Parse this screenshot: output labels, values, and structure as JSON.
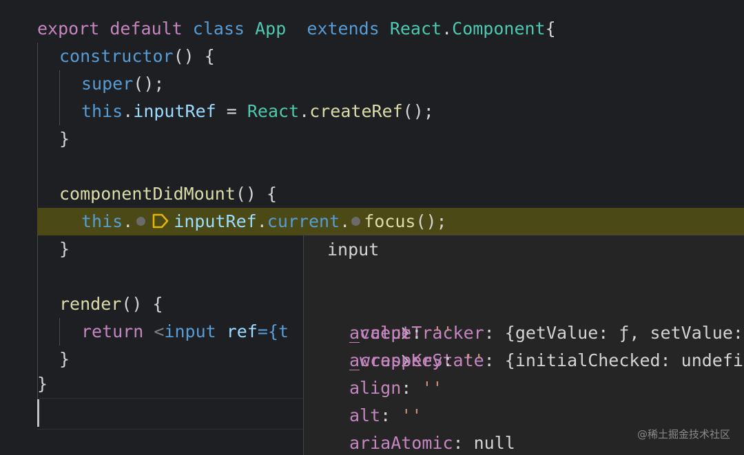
{
  "code": {
    "line1": {
      "export": "export",
      "default": "default",
      "class": "class",
      "name": "App",
      "extends": "extends",
      "react": "React",
      "dot": ".",
      "component": "Component",
      "brace": "{"
    },
    "line2": {
      "ctor": "constructor",
      "rest": "() {"
    },
    "line3": {
      "super": "super",
      "rest": "();"
    },
    "line4": {
      "this": "this",
      "dot": ".",
      "prop": "inputRef",
      "eq": " = ",
      "react": "React",
      "dot2": ".",
      "fn": "createRef",
      "rest": "();"
    },
    "line5": {
      "close": "}"
    },
    "line7": {
      "fn": "componentDidMount",
      "rest": "() {"
    },
    "line8": {
      "this": "this",
      "dot1": ".",
      "prop1": "inputRef",
      "dot2": ".",
      "prop2": "current",
      "dot3": ".",
      "fn": "focus",
      "rest": "();"
    },
    "line9": {
      "close": "}"
    },
    "line11": {
      "fn": "render",
      "rest": "() {"
    },
    "line12": {
      "ret": "return",
      "lt": " <",
      "tag": "input",
      "attr": " ref",
      "eq": "={",
      "partial": "t"
    },
    "line13": {
      "close": "}"
    },
    "line14": {
      "close": "}"
    }
  },
  "hover": {
    "title": "input",
    "rows": [
      {
        "key": "_valueTracker",
        "sep": ": ",
        "value": "{getValue: ƒ, setValue: ƒ",
        "type": "obj",
        "expandable": true
      },
      {
        "key": "_wrapperState",
        "sep": ": ",
        "value": "{initialChecked: undefined",
        "type": "obj",
        "expandable": true
      },
      {
        "key": "accept",
        "sep": ": ",
        "value": "''",
        "type": "str",
        "expandable": false
      },
      {
        "key": "accessKey",
        "sep": ": ",
        "value": "''",
        "type": "str",
        "expandable": false
      },
      {
        "key": "align",
        "sep": ": ",
        "value": "''",
        "type": "str",
        "expandable": false
      },
      {
        "key": "alt",
        "sep": ": ",
        "value": "''",
        "type": "str",
        "expandable": false
      },
      {
        "key": "ariaAtomic",
        "sep": ": ",
        "value": "null",
        "type": "null",
        "expandable": false
      }
    ]
  },
  "watermark": "@稀土掘金技术社区",
  "colors": {
    "keyword": "#c586c0",
    "storage": "#569cd6",
    "class": "#4ec9b0",
    "function": "#dcdcaa",
    "property": "#9cdcfe",
    "string": "#ce9178",
    "highlight": "#4b4a16",
    "background": "#1e1f22"
  }
}
